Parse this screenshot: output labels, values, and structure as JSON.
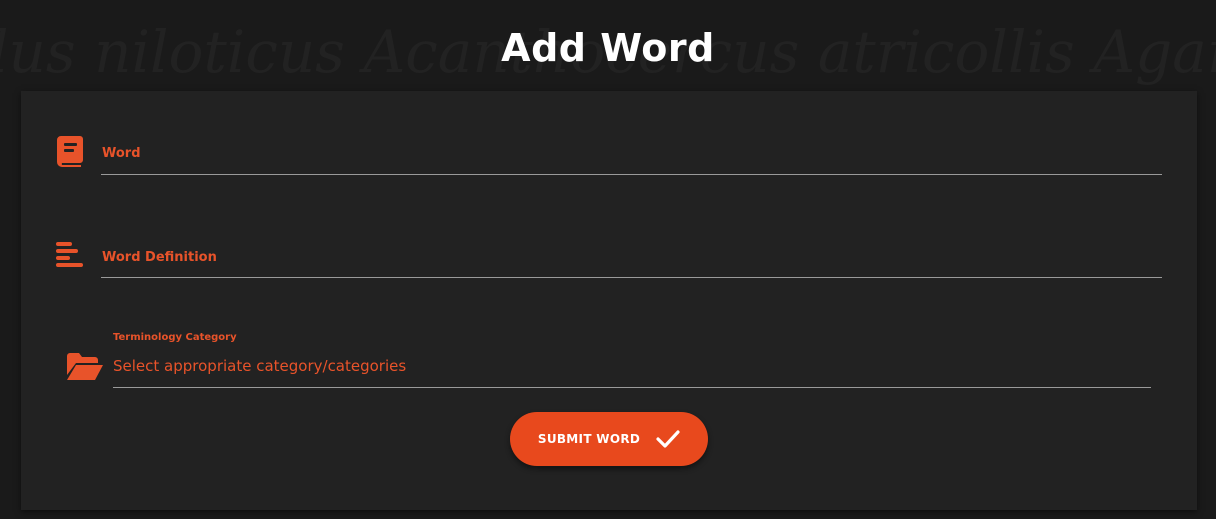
{
  "page": {
    "title": "Add Word",
    "background_text": [
      "lus niloticus Acanthocercus atricollis Agama"
    ]
  },
  "form": {
    "word": {
      "label": "Word",
      "icon": "book-icon"
    },
    "definition": {
      "label": "Word Definition",
      "icon": "text-lines-icon"
    },
    "category": {
      "label": "Terminology Category",
      "placeholder": "Select appropriate category/categories",
      "icon": "folder-open-icon"
    },
    "submit": {
      "label": "SUBMIT WORD",
      "icon": "check-icon"
    }
  },
  "colors": {
    "accent": "#e8491d",
    "label": "#e8532a",
    "card": "#222222",
    "background": "#1a1a1a"
  }
}
